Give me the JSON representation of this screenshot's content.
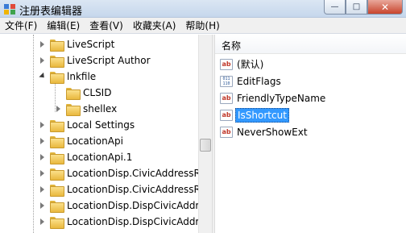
{
  "window": {
    "title": "注册表编辑器",
    "controls": {
      "minimize": "—",
      "maximize": "□",
      "close": "✕"
    }
  },
  "menu": [
    "文件(F)",
    "编辑(E)",
    "查看(V)",
    "收藏夹(A)",
    "帮助(H)"
  ],
  "tree": {
    "items": [
      {
        "label": "LiveScript",
        "level": 0,
        "state": "closed"
      },
      {
        "label": "LiveScript Author",
        "level": 0,
        "state": "closed"
      },
      {
        "label": "lnkfile",
        "level": 0,
        "state": "open"
      },
      {
        "label": "CLSID",
        "level": 1,
        "state": "none"
      },
      {
        "label": "shellex",
        "level": 1,
        "state": "closed"
      },
      {
        "label": "Local Settings",
        "level": 0,
        "state": "closed"
      },
      {
        "label": "LocationApi",
        "level": 0,
        "state": "closed"
      },
      {
        "label": "LocationApi.1",
        "level": 0,
        "state": "closed"
      },
      {
        "label": "LocationDisp.CivicAddressRe",
        "level": 0,
        "state": "closed"
      },
      {
        "label": "LocationDisp.CivicAddressRe",
        "level": 0,
        "state": "closed"
      },
      {
        "label": "LocationDisp.DispCivicAddre",
        "level": 0,
        "state": "closed"
      },
      {
        "label": "LocationDisp.DispCivicAddre",
        "level": 0,
        "state": "closed"
      }
    ]
  },
  "list": {
    "header_name": "名称",
    "values": [
      {
        "name": "(默认)",
        "type": "string",
        "icon": "string-value-icon",
        "selected": false
      },
      {
        "name": "EditFlags",
        "type": "binary",
        "icon": "binary-value-icon",
        "selected": false
      },
      {
        "name": "FriendlyTypeName",
        "type": "string",
        "icon": "string-value-icon",
        "selected": false
      },
      {
        "name": "IsShortcut",
        "type": "string",
        "icon": "string-value-icon",
        "selected": true
      },
      {
        "name": "NeverShowExt",
        "type": "string",
        "icon": "string-value-icon",
        "selected": false
      }
    ]
  },
  "colors": {
    "selection": "#3399ff",
    "folder": "#e9b83e",
    "titlebar": "#c6d7ec"
  }
}
